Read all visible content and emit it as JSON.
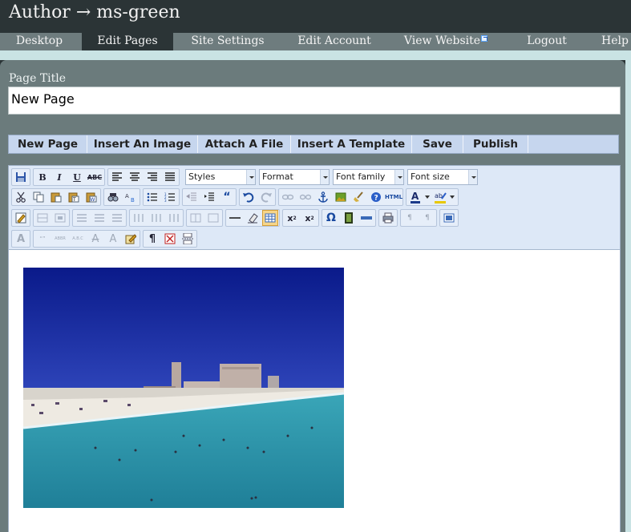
{
  "header": {
    "title": "Author → ms-green"
  },
  "nav": {
    "items": [
      {
        "label": "Desktop"
      },
      {
        "label": "Edit Pages",
        "active": true
      },
      {
        "label": "Site Settings"
      },
      {
        "label": "Edit Account"
      },
      {
        "label": "View Website",
        "external": true
      },
      {
        "label": "Logout"
      },
      {
        "label": "Help"
      }
    ]
  },
  "page_title": {
    "label": "Page Title",
    "value": "New Page"
  },
  "actions": {
    "new_page": "New Page",
    "insert_image": "Insert An Image",
    "attach_file": "Attach A File",
    "insert_template": "Insert A Template",
    "save": "Save",
    "publish": "Publish"
  },
  "toolbar": {
    "styles": "Styles",
    "format": "Format",
    "font_family": "Font family",
    "font_size": "Font size",
    "bold": "B",
    "italic": "I",
    "underline": "U",
    "strikethrough": "ABC",
    "html": "HTML",
    "omega": "Ω",
    "pilcrow": "¶",
    "icons_row1": [
      "save-icon",
      "bold-icon",
      "italic-icon",
      "underline-icon",
      "strikethrough-icon",
      "align-left-icon",
      "align-center-icon",
      "align-right-icon",
      "align-justify-icon"
    ],
    "icons_row2": [
      "cut-icon",
      "copy-icon",
      "paste-icon",
      "paste-text-icon",
      "paste-word-icon",
      "find-icon",
      "replace-icon",
      "bullet-list-icon",
      "numbered-list-icon",
      "outdent-icon",
      "indent-icon",
      "blockquote-icon",
      "undo-icon",
      "redo-icon",
      "link-icon",
      "unlink-icon",
      "anchor-icon",
      "image-icon",
      "cleanup-icon",
      "help-icon",
      "html-icon",
      "forecolor-icon",
      "backcolor-icon"
    ],
    "icons_row3": [
      "edit-icon",
      "table-icon",
      "subscript-icon",
      "superscript-icon",
      "special-char-icon",
      "media-icon",
      "hr-icon",
      "print-icon",
      "fullscreen-icon"
    ],
    "icons_row4": [
      "styleprops-icon",
      "cite-icon",
      "abbr-icon",
      "acronym-icon",
      "del-icon",
      "ins-icon",
      "attribs-icon",
      "visualchars-icon",
      "nonbreaking-icon",
      "pagebreak-icon"
    ]
  },
  "content": {
    "image": "beach-photo"
  },
  "colors": {
    "header_bg": "#2b3436",
    "nav_bg": "#6e7c7e",
    "panel_bg": "#6b7b7c",
    "accent_light": "#c9e3e4",
    "action_bar": "#c6d6ee"
  }
}
